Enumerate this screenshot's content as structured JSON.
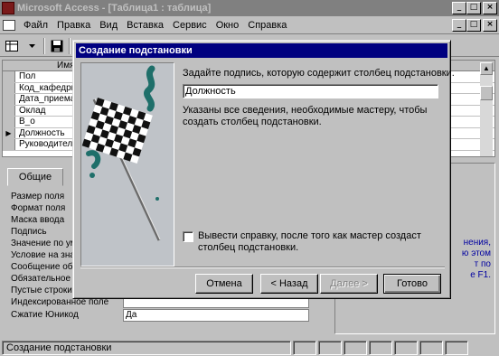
{
  "window": {
    "title": "Microsoft Access - [Таблица1 : таблица]",
    "controls": [
      "_",
      "□",
      "×"
    ]
  },
  "menu": {
    "items": [
      "Файл",
      "Правка",
      "Вид",
      "Вставка",
      "Сервис",
      "Окно",
      "Справка"
    ],
    "doc_controls": [
      "_",
      "□",
      "×"
    ]
  },
  "field_grid": {
    "column_header": "Имя п",
    "rows": [
      "Пол",
      "Код_кафедры",
      "Дата_приема",
      "Оклад",
      "В_о",
      "Должность",
      "Руководитель"
    ],
    "current_row_marker": "▶"
  },
  "properties": {
    "tab": "Общие",
    "rows": [
      {
        "label": "Размер поля",
        "value": ""
      },
      {
        "label": "Формат поля",
        "value": ""
      },
      {
        "label": "Маска ввода",
        "value": ""
      },
      {
        "label": "Подпись",
        "value": ""
      },
      {
        "label": "Значение по ум",
        "value": ""
      },
      {
        "label": "Условие на зна",
        "value": ""
      },
      {
        "label": "Сообщение об",
        "value": ""
      },
      {
        "label": "Обязательное",
        "value": ""
      },
      {
        "label": "Пустые строки",
        "value": ""
      },
      {
        "label": "Индексированное поле",
        "value": ""
      },
      {
        "label": "Сжатие Юникод",
        "value": "Да"
      }
    ]
  },
  "help_text": [
    "нения,",
    "ю этом",
    "т по",
    "е F1."
  ],
  "status": {
    "text": "Создание подстановки"
  },
  "wizard": {
    "title": "Создание подстановки",
    "prompt": "Задайте подпись, которую содержит столбец подстановки.",
    "answer_value": "Должность",
    "info": "Указаны все сведения, необходимые мастеру, чтобы создать столбец подстановки.",
    "help_checkbox_label": "Вывести справку, после того как мастер создаст столбец подстановки.",
    "help_checked": false,
    "buttons": {
      "cancel": "Отмена",
      "back": "< Назад",
      "next": "Далее >",
      "finish": "Готово"
    }
  }
}
